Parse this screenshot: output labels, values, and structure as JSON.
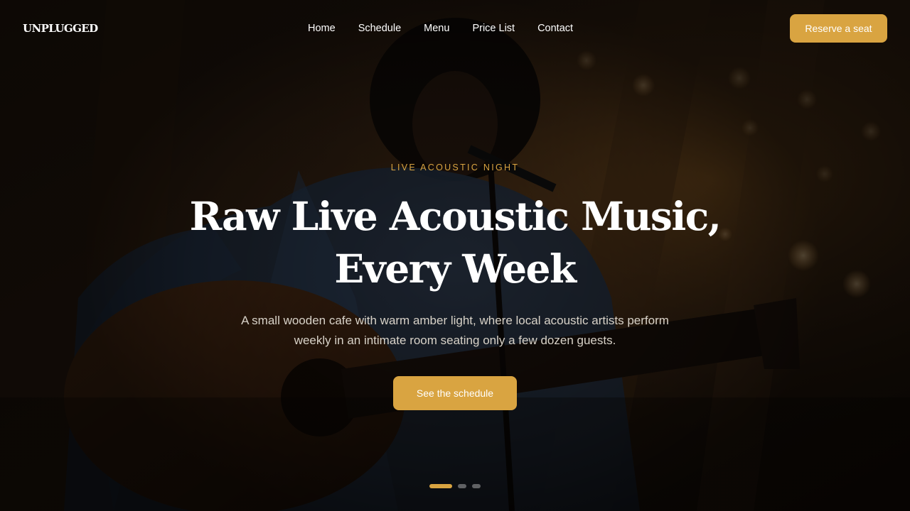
{
  "brand": {
    "logo": "UNPLUGGED"
  },
  "nav": {
    "links": [
      "Home",
      "Schedule",
      "Menu",
      "Price List",
      "Contact"
    ],
    "reserve_label": "Reserve a seat"
  },
  "hero": {
    "eyebrow": "LIVE ACOUSTIC NIGHT",
    "headline": "Raw Live Acoustic Music, Every Week",
    "subtext": "A small wooden cafe with warm amber light, where local acoustic artists perform weekly in an intimate room seating only a few dozen guests.",
    "cta_label": "See the schedule",
    "background_image": "musician-playing-acoustic-guitar-photo"
  },
  "carousel": {
    "slide_count": 3,
    "active_index": 0
  },
  "colors": {
    "accent": "#d9a441",
    "text": "#ffffff",
    "muted_text": "#d8d2c8"
  }
}
